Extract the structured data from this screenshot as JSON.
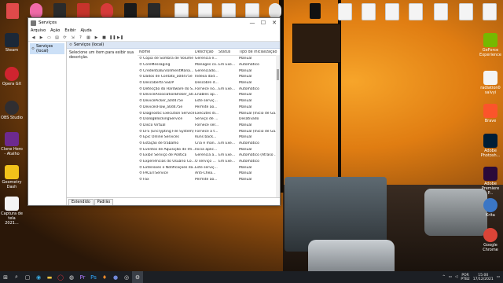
{
  "desktop": {
    "left_icons": [
      {
        "label": "Steam",
        "color": "#1b2838"
      },
      {
        "label": "Opera GX",
        "color": "#d0242f"
      },
      {
        "label": "OBS Studio",
        "color": "#302e31"
      },
      {
        "label": "Clone Hero - Atalho",
        "color": "#6d2a8f"
      },
      {
        "label": "Geometry Dash",
        "color": "#f2c21a"
      },
      {
        "label": "Captura de tela 2021...",
        "color": "#f4f4f4"
      }
    ],
    "right_icons": [
      {
        "label": "GeForce Experience",
        "color": "#76b900"
      },
      {
        "label": "radiation0 salvyi",
        "color": "#f4f4f4"
      },
      {
        "label": "Brave",
        "color": "#fb542b"
      },
      {
        "label": "Adobe Photosh...",
        "color": "#001e36"
      },
      {
        "label": "Adobe Premiere P...",
        "color": "#2a0a3a"
      },
      {
        "label": "Krita",
        "color": "#3b76c5"
      },
      {
        "label": "Google Chrome",
        "color": "#db4437"
      }
    ]
  },
  "window": {
    "title": "Serviços",
    "minimize_glyph": "—",
    "maximize_glyph": "☐",
    "close_glyph": "✕",
    "menu": [
      "Arquivo",
      "Ação",
      "Exibir",
      "Ajuda"
    ],
    "tree_item": "Serviços (local)",
    "header": "Serviços (local)",
    "description": "Selecione um item para exibir sua descrição.",
    "columns": [
      "Nome",
      "Descrição",
      "Status",
      "Tipo de Inicialização"
    ],
    "rows": [
      [
        "Cópia de Sombra de Volume",
        "Gerencia e...",
        "",
        "Manual"
      ],
      [
        "CoreMessaging",
        "Manages co...",
        "Em Exe...",
        "Automático"
      ],
      [
        "CredentialEnrollmentMana...",
        "Gerenciado...",
        "",
        "Manual"
      ],
      [
        "Dados de Contato_a0d475e",
        "Indexa dad...",
        "",
        "Manual"
      ],
      [
        "Descoberta SSDP",
        "Descobre d...",
        "",
        "Manual"
      ],
      [
        "Detecção do Hardware do S...",
        "Fornece no...",
        "Em Exe...",
        "Automático"
      ],
      [
        "DeviceAssociationBroker_a0...",
        "Enables ap...",
        "",
        "Manual"
      ],
      [
        "DevicePicker_a0d475e",
        "Este serviç...",
        "",
        "Manual"
      ],
      [
        "DevicesFlow_a0d475e",
        "Permite ao...",
        "",
        "Manual"
      ],
      [
        "Diagnostic Execution Service",
        "Executes di...",
        "",
        "Manual (Inicio de Ga..."
      ],
      [
        "DialogBlockingService",
        "Serviço de ...",
        "",
        "Desativado"
      ],
      [
        "Disco Virtual",
        "Fornece ser...",
        "",
        "Manual"
      ],
      [
        "EFS (Encrypting File System)",
        "Fornece a t...",
        "",
        "Manual (Inicio de Ga..."
      ],
      [
        "Epic Online Services",
        "Runs back...",
        "",
        "Manual"
      ],
      [
        "Estação de trabalho",
        "Cria e man...",
        "Em Exe...",
        "Automático"
      ],
      [
        "Eventos de Aquisição de Im...",
        "Inicia aplic...",
        "",
        "Manual"
      ],
      [
        "Exibir Serviço de Política",
        "Gerencia a...",
        "Em Exe...",
        "Automático (Atraso ..."
      ],
      [
        "Experiências do Usuário Co...",
        "O serviço ...",
        "Em Exe...",
        "Automático"
      ],
      [
        "Extensões e Notificações da...",
        "Este serviç...",
        "",
        "Manual"
      ],
      [
        "FACEITService",
        "Anti-Chea...",
        "",
        "Manual"
      ],
      [
        "Fax",
        "Permite ao...",
        "",
        "Manual"
      ]
    ],
    "tabs": [
      "Estendido",
      "Padrão"
    ]
  },
  "taskbar": {
    "language": "POR",
    "layout": "PTB2",
    "time": "15:00",
    "date": "17/12/2021"
  },
  "colors": {
    "accent_select": "#cce0f7",
    "taskbar_bg": "#1c1f24"
  }
}
